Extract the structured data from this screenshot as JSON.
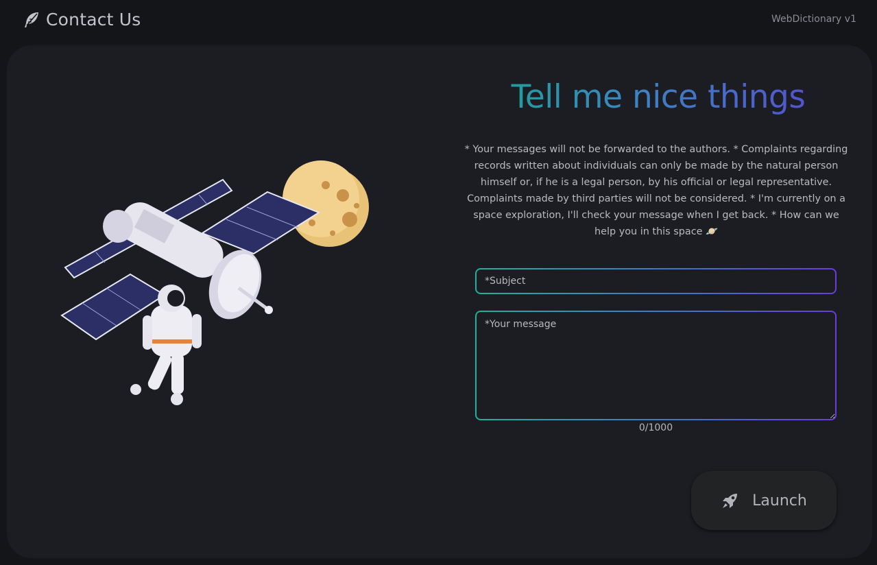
{
  "header": {
    "title": "Contact Us",
    "version": "WebDictionary v1",
    "logo_icon": "feather-icon"
  },
  "contact": {
    "heading": "Tell me nice things",
    "notice": "* Your messages will not be forwarded to the authors. * Complaints regarding records written about individuals can only be made by the natural person himself or, if he is a legal person, by his official or legal representative. Complaints made by third parties will not be considered. * I'm currently on a space exploration, I'll check your message when I get back. * How can we help you in this space 🪐",
    "subject_placeholder": "*Subject",
    "subject_value": "",
    "message_placeholder": "*Your message",
    "message_value": "",
    "counter": "0/1000",
    "launch_label": "Launch",
    "launch_icon": "rocket-icon"
  },
  "colors": {
    "background": "#141518",
    "card": "#1c1d22",
    "gradient_start": "#17a88e",
    "gradient_mid": "#3d84c4",
    "gradient_end": "#5a44cf"
  }
}
